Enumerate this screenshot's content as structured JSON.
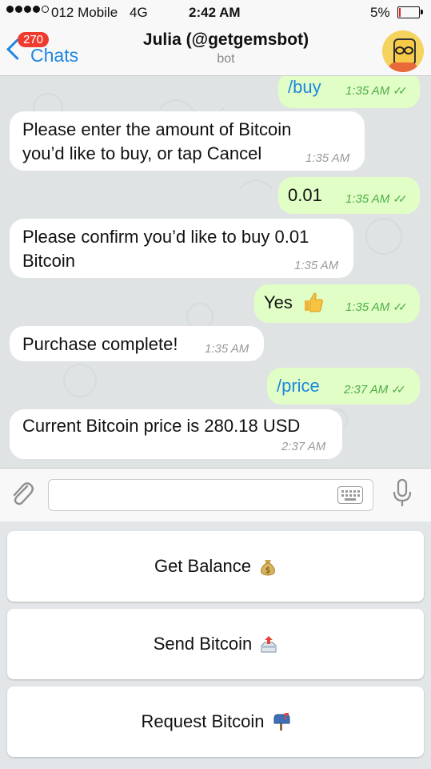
{
  "status": {
    "carrier": "012 Mobile",
    "network": "4G",
    "time": "2:42 AM",
    "battery": "5%"
  },
  "nav": {
    "back_label": "Chats",
    "unread_badge": "270",
    "title": "Julia (@getgemsbot)",
    "subtitle": "bot"
  },
  "messages": [
    {
      "direction": "out",
      "text": "/buy",
      "time": "1:35 AM",
      "ticks": "✓✓"
    },
    {
      "direction": "in",
      "lines": [
        "Please enter the amount of Bitcoin",
        "you’d like to buy, or tap Cancel"
      ],
      "time": "1:35 AM"
    },
    {
      "direction": "out",
      "text": "0.01",
      "time": "1:35 AM",
      "ticks": "✓✓"
    },
    {
      "direction": "in",
      "lines": [
        "Please confirm you’d like to buy 0.01",
        "Bitcoin"
      ],
      "time": "1:35 AM"
    },
    {
      "direction": "out",
      "text": "Yes",
      "emoji": "thumbs-up-icon",
      "time": "1:35 AM",
      "ticks": "✓✓"
    },
    {
      "direction": "in",
      "lines": [
        "Purchase complete!"
      ],
      "time": "1:35 AM"
    },
    {
      "direction": "out",
      "text": "/price",
      "time": "2:37 AM",
      "ticks": "✓✓"
    },
    {
      "direction": "in",
      "lines": [
        "Current Bitcoin price is 280.18 USD"
      ],
      "time": "2:37 AM"
    }
  ],
  "composer": {
    "placeholder": ""
  },
  "keyboard": {
    "buttons": [
      {
        "label": "Get Balance",
        "icon": "money-bag-icon"
      },
      {
        "label": "Send Bitcoin",
        "icon": "outbox-tray-icon"
      },
      {
        "label": "Request Bitcoin",
        "icon": "mailbox-icon"
      }
    ]
  },
  "colors": {
    "accent": "#1f86e0",
    "outgoing_bubble": "#e1fec6",
    "incoming_bubble": "#ffffff",
    "badge": "#ef3b2f",
    "ticks": "#4fae4a"
  }
}
